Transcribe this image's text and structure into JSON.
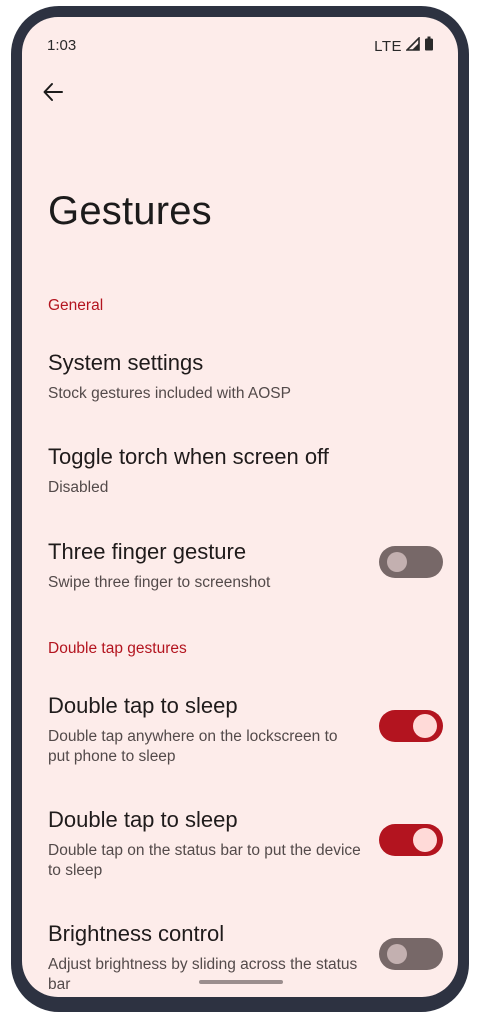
{
  "status_bar": {
    "time": "1:03",
    "network": "LTE"
  },
  "header": {
    "title": "Gestures"
  },
  "sections": {
    "general": {
      "label": "General"
    },
    "double_tap": {
      "label": "Double tap gestures"
    }
  },
  "settings": [
    {
      "title": "System settings",
      "subtitle": "Stock gestures included with AOSP"
    },
    {
      "title": "Toggle torch when screen off",
      "subtitle": "Disabled"
    },
    {
      "title": "Three finger gesture",
      "subtitle": "Swipe three finger to screenshot",
      "enabled": false
    },
    {
      "title": "Double tap to sleep",
      "subtitle": "Double tap anywhere on the lockscreen to put phone to sleep",
      "enabled": true
    },
    {
      "title": "Double tap to sleep",
      "subtitle": "Double tap on the status bar to put the device to sleep",
      "enabled": true
    },
    {
      "title": "Brightness control",
      "subtitle": "Adjust brightness by sliding across the status bar",
      "enabled": false
    }
  ],
  "colors": {
    "accent": "#b3141f",
    "background": "#fdecea",
    "frame": "#2d3241"
  }
}
